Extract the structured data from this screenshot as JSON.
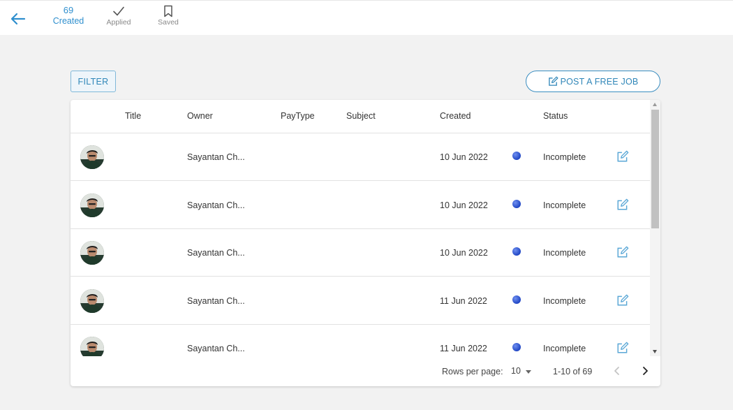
{
  "nav": {
    "tabs": [
      {
        "count": "69",
        "label": "Created"
      },
      {
        "label": "Applied"
      },
      {
        "label": "Saved"
      }
    ]
  },
  "toolbar": {
    "filter_label": "FILTER",
    "post_label": "POST A FREE JOB"
  },
  "table": {
    "columns": [
      "Title",
      "Owner",
      "PayType",
      "Subject",
      "Created",
      "Status"
    ],
    "rows": [
      {
        "title": "",
        "owner": "Sayantan Ch...",
        "paytype": "",
        "subject": "",
        "created": "10 Jun 2022",
        "status": "Incomplete"
      },
      {
        "title": "",
        "owner": "Sayantan Ch...",
        "paytype": "",
        "subject": "",
        "created": "10 Jun 2022",
        "status": "Incomplete"
      },
      {
        "title": "",
        "owner": "Sayantan Ch...",
        "paytype": "",
        "subject": "",
        "created": "10 Jun 2022",
        "status": "Incomplete"
      },
      {
        "title": "",
        "owner": "Sayantan Ch...",
        "paytype": "",
        "subject": "",
        "created": "11 Jun 2022",
        "status": "Incomplete"
      },
      {
        "title": "",
        "owner": "Sayantan Ch...",
        "paytype": "",
        "subject": "",
        "created": "11 Jun 2022",
        "status": "Incomplete"
      }
    ]
  },
  "pagination": {
    "rows_per_page_label": "Rows per page:",
    "rows_per_page": "10",
    "range": "1-10 of 69"
  },
  "colors": {
    "accent": "#2f8fce",
    "status_dot": "#3055d8"
  }
}
